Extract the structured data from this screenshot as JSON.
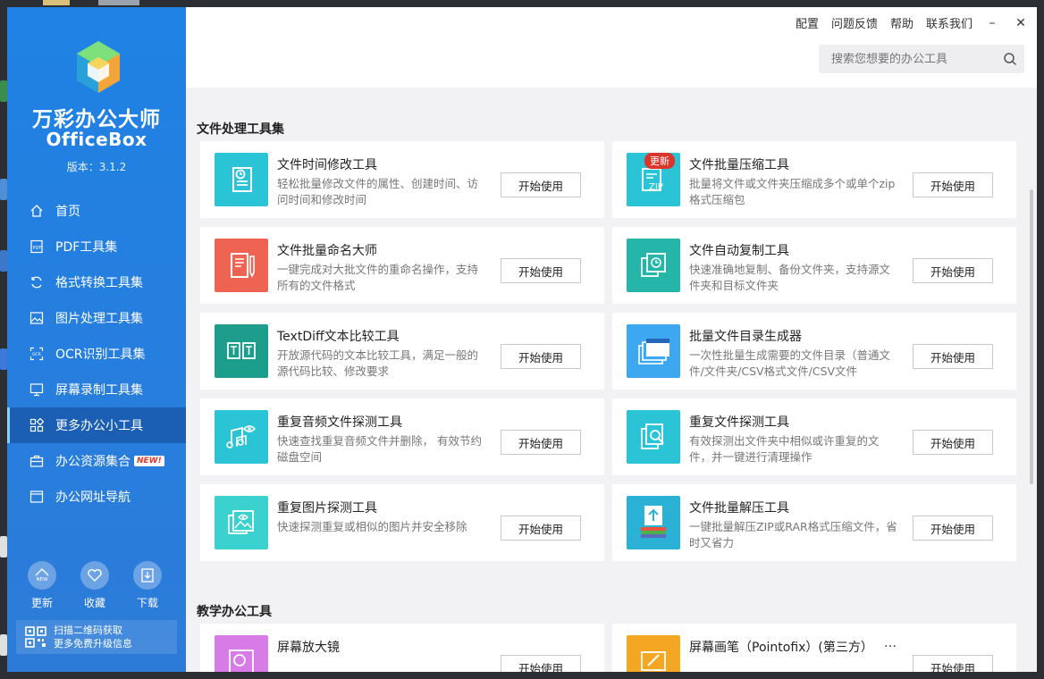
{
  "sidebar": {
    "app_name": "万彩办公大师",
    "app_name_en": "OfficeBox",
    "version": "版本：3.1.2",
    "nav": [
      {
        "label": "首页",
        "icon": "home-icon"
      },
      {
        "label": "PDF工具集",
        "icon": "pdf-icon"
      },
      {
        "label": "格式转换工具集",
        "icon": "convert-icon"
      },
      {
        "label": "图片处理工具集",
        "icon": "image-icon"
      },
      {
        "label": "OCR识别工具集",
        "icon": "ocr-icon"
      },
      {
        "label": "屏幕录制工具集",
        "icon": "monitor-icon"
      },
      {
        "label": "更多办公小工具",
        "icon": "grid-icon",
        "active": true
      },
      {
        "label": "办公资源集合",
        "icon": "briefcase-icon",
        "badge": "NEW!"
      },
      {
        "label": "办公网址导航",
        "icon": "browser-icon"
      }
    ],
    "bottom": [
      {
        "label": "更新",
        "icon": "new-icon",
        "icon_text": "NEW"
      },
      {
        "label": "收藏",
        "icon": "heart-icon"
      },
      {
        "label": "下载",
        "icon": "download-icon"
      }
    ],
    "qr_line1": "扫描二维码获取",
    "qr_line2": "更多免费升级信息"
  },
  "topbar": {
    "links": [
      "配置",
      "问题反馈",
      "帮助",
      "联系我们"
    ],
    "minimize": "–",
    "close": "✕",
    "search_placeholder": "搜索您想要的办公工具"
  },
  "sections": [
    {
      "title": "文件处理工具集",
      "cards": [
        {
          "title": "文件时间修改工具",
          "desc": "轻松批量修改文件的属性、创建时间、访问时间和修改时间",
          "button": "开始使用",
          "icon": "file-clock-icon",
          "color": "#2bc4d6"
        },
        {
          "title": "文件批量压缩工具",
          "desc": "批量将文件或文件夹压缩成多个或单个zip格式压缩包",
          "button": "开始使用",
          "icon": "zip-icon",
          "color": "#2bc4d6",
          "badge": "更新"
        },
        {
          "title": "文件批量命名大师",
          "desc": "一键完成对大批文件的重命名操作，支持所有的文件格式",
          "button": "开始使用",
          "icon": "rename-icon",
          "color": "#ee6352"
        },
        {
          "title": "文件自动复制工具",
          "desc": "快速准确地复制、备份文件夹，支持源文件夹和目标文件夹",
          "button": "开始使用",
          "icon": "copy-clock-icon",
          "color": "#26b5a9"
        },
        {
          "title": "TextDiff文本比较工具",
          "desc": "开放源代码的文本比较工具，满足一般的源代码比较、修改要求",
          "button": "开始使用",
          "icon": "text-compare-icon",
          "color": "#1d9e8c"
        },
        {
          "title": "批量文件目录生成器",
          "desc": "一次性批量生成需要的文件目录（普通文件/文件夹/CSV格式文件/CSV文件",
          "button": "开始使用",
          "icon": "folder-list-icon",
          "color": "#3da8f0"
        },
        {
          "title": "重复音频文件探测工具",
          "desc": "快速查找重复音频文件并删除， 有效节约磁盘空间",
          "button": "开始使用",
          "icon": "music-eye-icon",
          "color": "#2bc4d6"
        },
        {
          "title": "重复文件探测工具",
          "desc": "有效探测出文件夹中相似或许重复的文件，并一键进行清理操作",
          "button": "开始使用",
          "icon": "file-search-icon",
          "color": "#2bc4d6"
        },
        {
          "title": "重复图片探测工具",
          "desc": "快速探测重复或相似的图片并安全移除",
          "button": "开始使用",
          "icon": "image-eye-icon",
          "color": "#3ad1cf"
        },
        {
          "title": "文件批量解压工具",
          "desc": "一键批量解压ZIP或RAR格式压缩文件，省时又省力",
          "button": "开始使用",
          "icon": "unzip-icon",
          "color": "#2bb0d6"
        }
      ]
    },
    {
      "title": "教学办公工具",
      "cards": [
        {
          "title": "屏幕放大镜",
          "desc": "",
          "button": "开始使用",
          "icon": "magnifier-icon",
          "color": "#d77be6"
        },
        {
          "title": "屏幕画笔（Pointofix）(第三方）",
          "desc": "",
          "button": "开始使用",
          "icon": "pen-icon",
          "color": "#f5a623",
          "more": "…"
        }
      ]
    }
  ]
}
